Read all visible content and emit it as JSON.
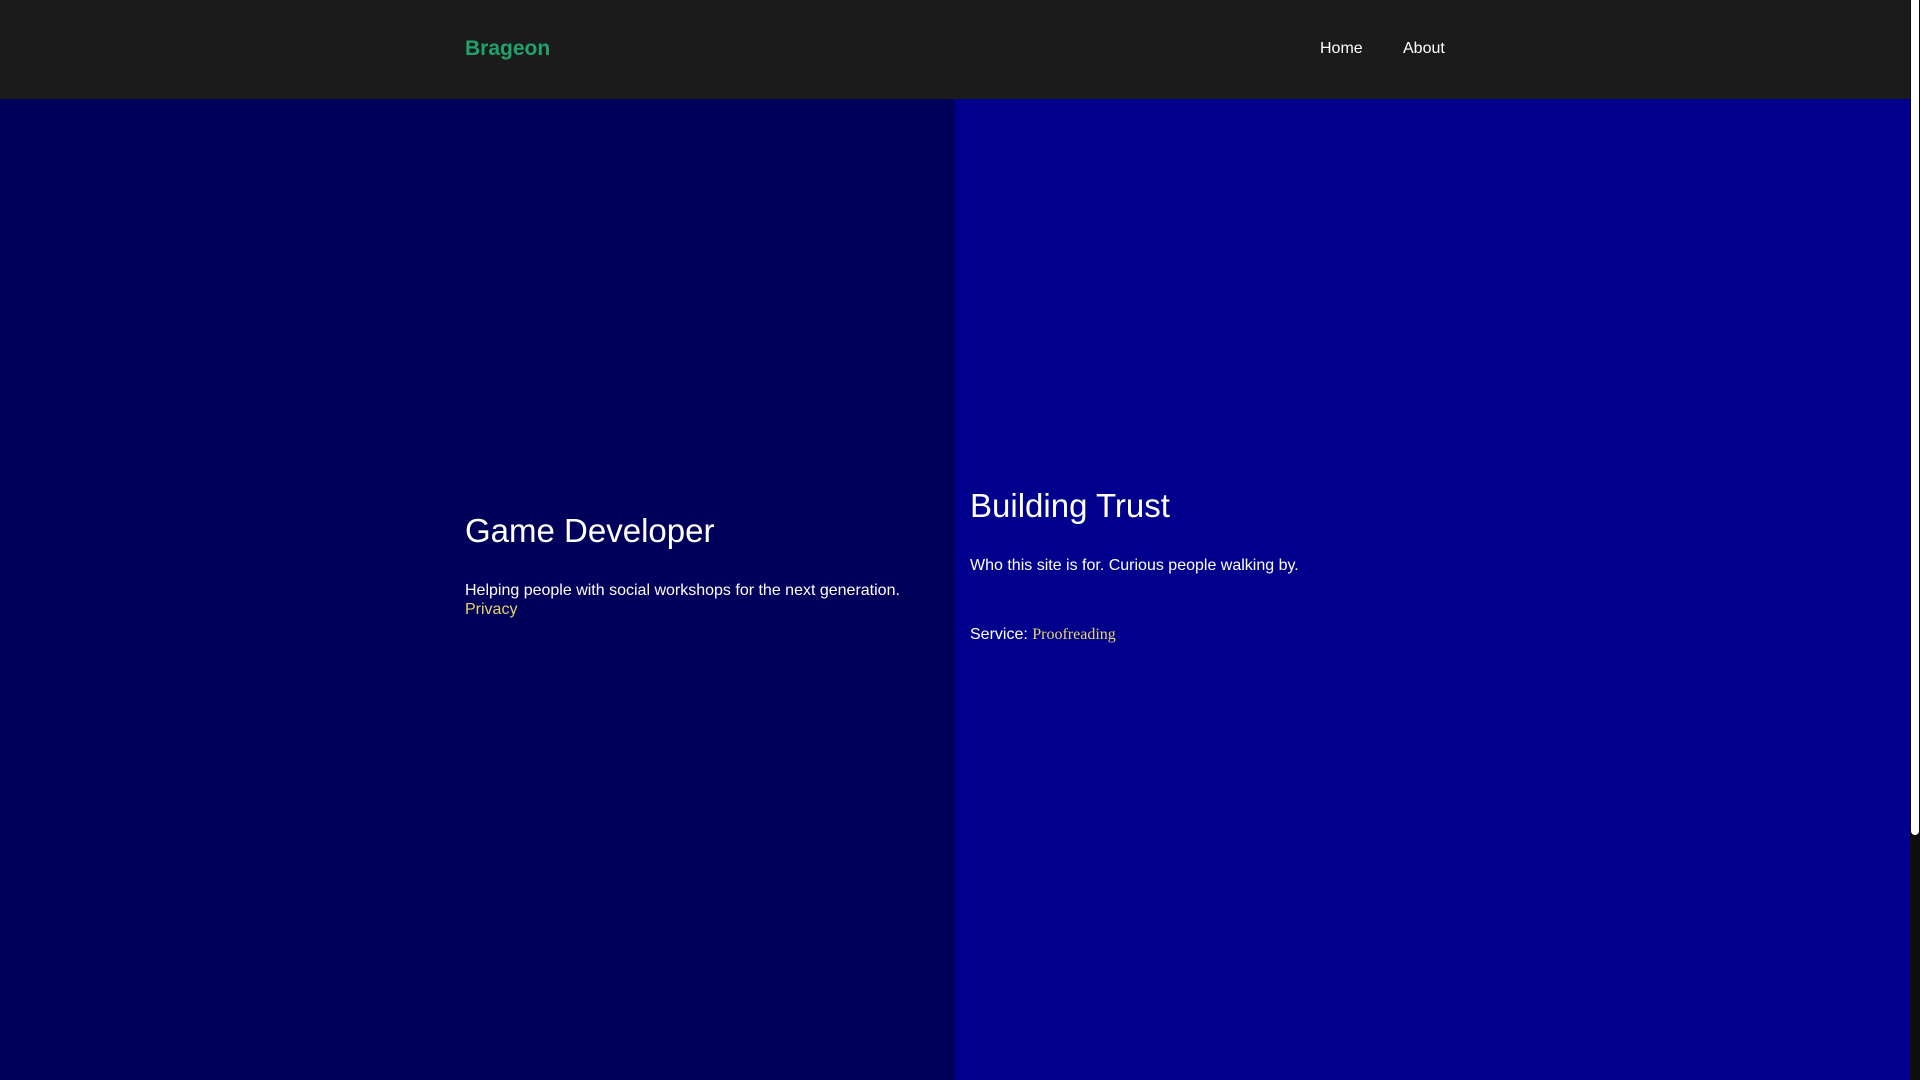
{
  "header": {
    "brand": "Brageon",
    "nav": {
      "home": "Home",
      "about": "About"
    }
  },
  "left_panel": {
    "title": "Game Developer",
    "description": "Helping people with social workshops for the next generation.",
    "link": "Privacy"
  },
  "right_panel": {
    "title": "Building Trust",
    "description": "Who this site is for. Curious people walking by.",
    "service_label": "Service:",
    "service_value": "Proofreading"
  },
  "colors": {
    "navbar_bg": "#1b1b1b",
    "brand": "#21a26b",
    "left_panel_bg": "#00005a",
    "right_panel_bg": "#00008c",
    "link": "#e7d46b"
  }
}
